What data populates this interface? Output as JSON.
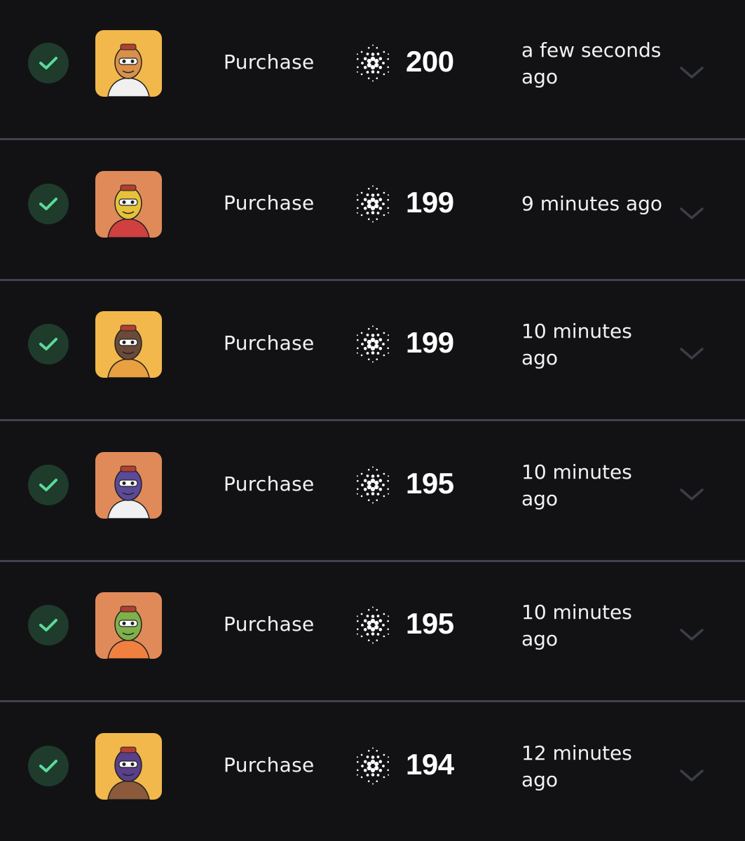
{
  "colors": {
    "background": "#121214",
    "divider": "#40434e",
    "check_bg": "#1f3b2c",
    "check_mark": "#5dd99a",
    "chevron": "#3b3e47"
  },
  "icons": {
    "status": "check-circle-icon",
    "currency": "cardano-ada-icon",
    "expand": "chevron-down-icon"
  },
  "transactions": [
    {
      "type": "Purchase",
      "price": "200",
      "time_line1": "a few seconds",
      "time_line2": "ago",
      "avatar_bg": "#f2b84b"
    },
    {
      "type": "Purchase",
      "price": "199",
      "time_line1": "9 minutes ago",
      "time_line2": "",
      "avatar_bg": "#e08a5a"
    },
    {
      "type": "Purchase",
      "price": "199",
      "time_line1": "10 minutes",
      "time_line2": "ago",
      "avatar_bg": "#f2b84b"
    },
    {
      "type": "Purchase",
      "price": "195",
      "time_line1": "10 minutes",
      "time_line2": "ago",
      "avatar_bg": "#e08a5a"
    },
    {
      "type": "Purchase",
      "price": "195",
      "time_line1": "10 minutes",
      "time_line2": "ago",
      "avatar_bg": "#e08a5a"
    },
    {
      "type": "Purchase",
      "price": "194",
      "time_line1": "12 minutes",
      "time_line2": "ago",
      "avatar_bg": "#f2b84b"
    }
  ]
}
